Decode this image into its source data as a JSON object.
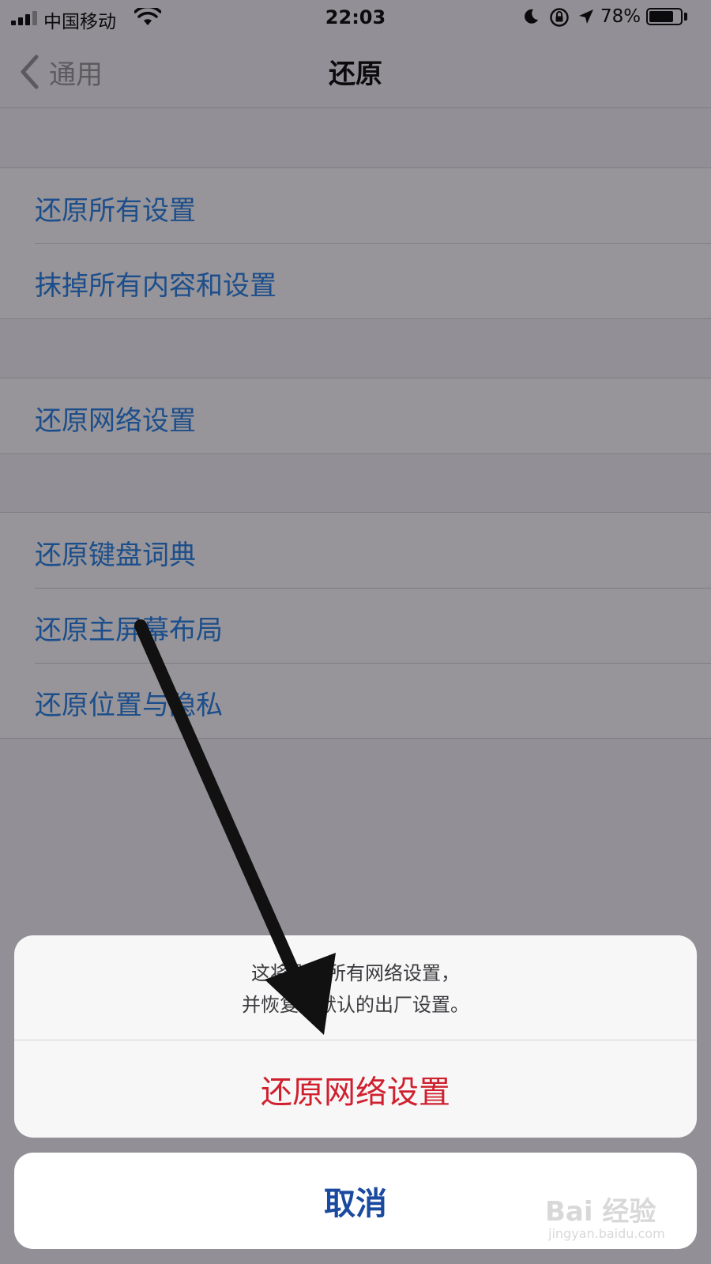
{
  "status_bar": {
    "carrier": "中国移动",
    "time": "22:03",
    "battery_percent": "78%",
    "battery_level": 0.78,
    "icons": [
      "signal-icon",
      "wifi-icon",
      "moon-icon",
      "rotation-lock-icon",
      "location-arrow-icon",
      "battery-icon"
    ]
  },
  "nav": {
    "back_label": "通用",
    "title": "还原"
  },
  "groups": {
    "group1": [
      "还原所有设置",
      "抹掉所有内容和设置"
    ],
    "group2": [
      "还原网络设置"
    ],
    "group3": [
      "还原键盘词典",
      "还原主屏幕布局",
      "还原位置与隐私"
    ]
  },
  "action_sheet": {
    "message_line1": "这将删除所有网络设置，",
    "message_line2": "并恢复其默认的出厂设置。",
    "destructive_label": "还原网络设置",
    "cancel_label": "取消"
  },
  "watermark": {
    "line1": "Bai 经验",
    "line2": "jingyan.baidu.com"
  },
  "colors": {
    "link_blue": "#1c4e8b",
    "destructive_red": "#d0202e",
    "cancel_blue": "#1a4aa0",
    "dim_background": "#929096"
  }
}
